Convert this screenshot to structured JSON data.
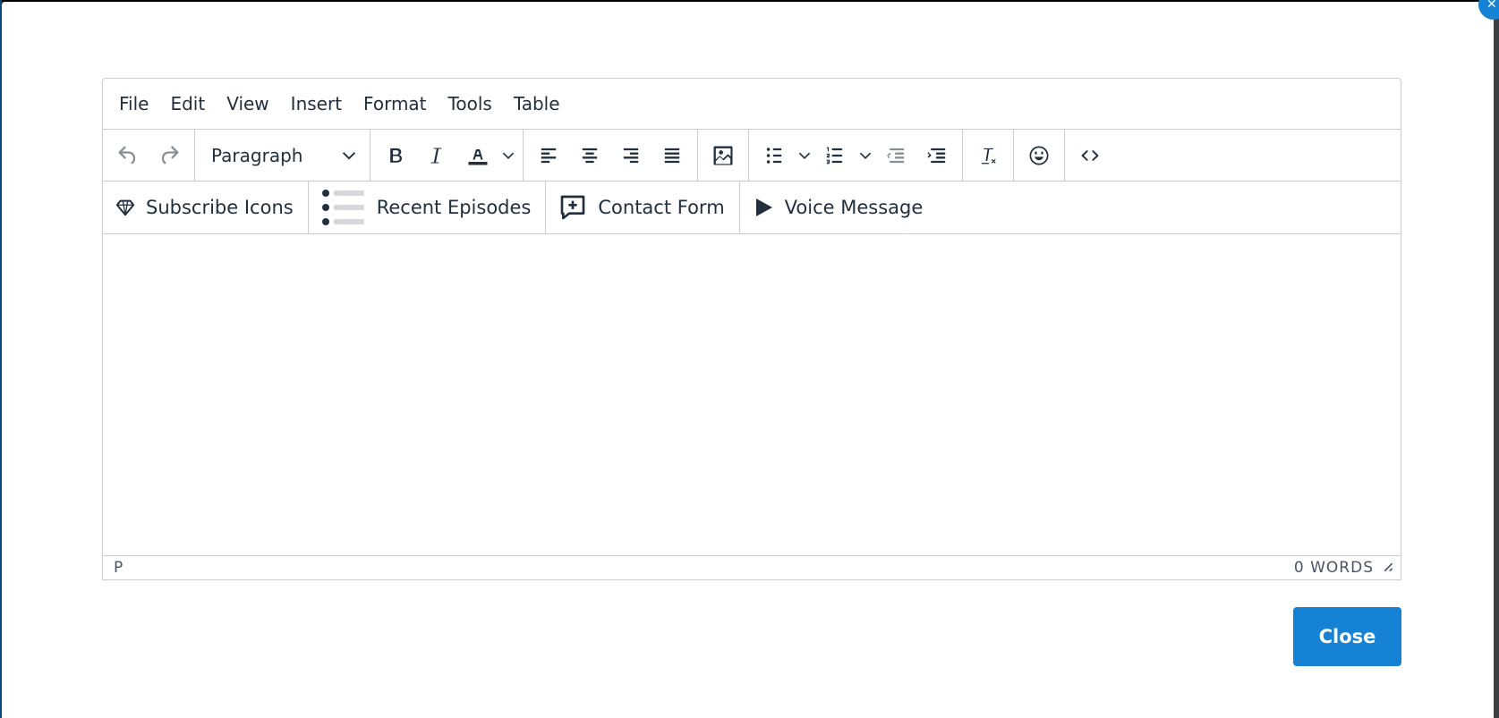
{
  "menubar": {
    "items": [
      "File",
      "Edit",
      "View",
      "Insert",
      "Format",
      "Tools",
      "Table"
    ]
  },
  "toolbar": {
    "undo_icon": "undo-icon",
    "redo_icon": "redo-icon",
    "block_format": "Paragraph",
    "bold_icon": "bold-icon",
    "italic_icon": "italic-icon",
    "text_color_icon": "text-color-icon",
    "align_left_icon": "align-left-icon",
    "align_center_icon": "align-center-icon",
    "align_right_icon": "align-right-icon",
    "align_justify_icon": "align-justify-icon",
    "image_icon": "image-icon",
    "bullet_list_icon": "bullet-list-icon",
    "numbered_list_icon": "numbered-list-icon",
    "outdent_icon": "outdent-icon",
    "indent_icon": "indent-icon",
    "clear_format_icon": "clear-formatting-icon",
    "emoji_icon": "emoji-icon",
    "source_code_icon": "source-code-icon"
  },
  "custom_toolbar": {
    "subscribe_icons": "Subscribe Icons",
    "recent_episodes": "Recent Episodes",
    "contact_form": "Contact Form",
    "voice_message": "Voice Message"
  },
  "statusbar": {
    "path": "P",
    "word_count": "0 WORDS"
  },
  "footer": {
    "close_label": "Close"
  },
  "colors": {
    "accent": "#1582d6",
    "toolbar_icon": "#222f3e",
    "disabled_icon": "#8a8f95",
    "border": "#cccccc"
  }
}
